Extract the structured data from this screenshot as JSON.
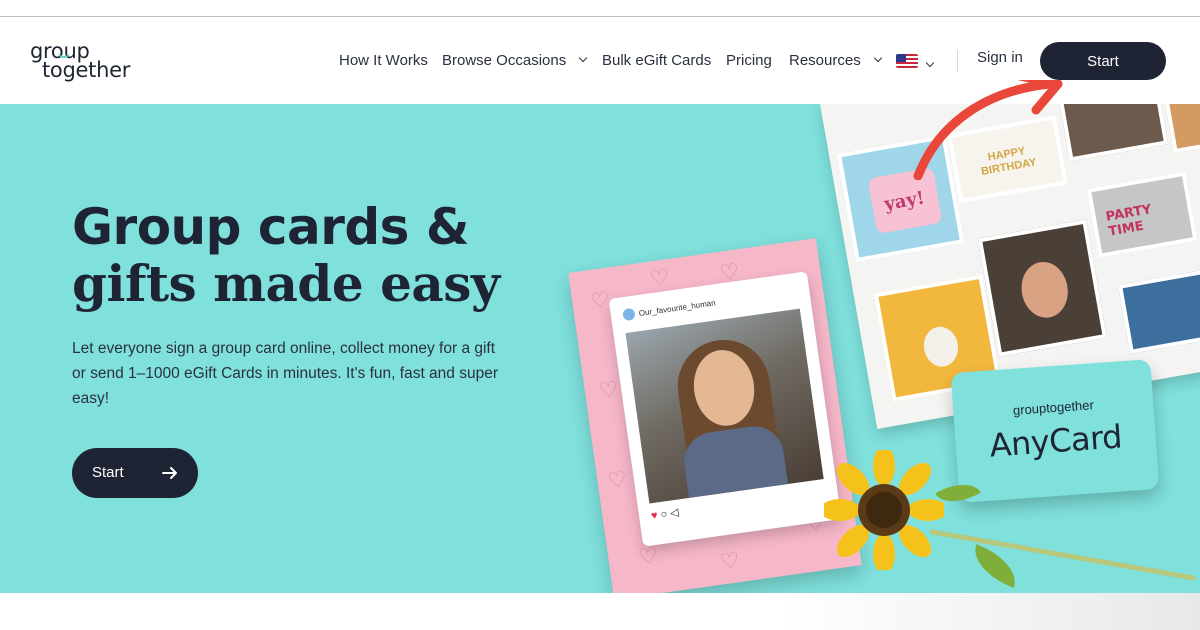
{
  "logo": {
    "line1": "group",
    "line2": "together"
  },
  "nav": {
    "items": [
      {
        "label": "How It Works",
        "dropdown": false
      },
      {
        "label": "Browse Occasions",
        "dropdown": true
      },
      {
        "label": "Bulk eGift Cards",
        "dropdown": false
      },
      {
        "label": "Pricing",
        "dropdown": false
      },
      {
        "label": "Resources",
        "dropdown": true
      }
    ],
    "locale_icon": "us-flag-icon",
    "sign_in": "Sign in",
    "start": "Start"
  },
  "hero": {
    "title_line1": "Group cards &",
    "title_line2": "gifts made easy",
    "subtitle": "Let everyone sign a group card online, collect money for a gift or send 1–1000 eGift Cards in minutes. It's fun, fast and super easy!",
    "cta_label": "Start",
    "cta_icon": "arrow-right-icon"
  },
  "collage": {
    "post_handle": "Our_favourite_human",
    "tiles_text": [
      "HAPPY BIRTHDAY",
      "yay!",
      "PARTY TIME"
    ],
    "anycard_brand": "grouptogether",
    "anycard_name": "AnyCard"
  },
  "colors": {
    "hero_bg": "#7fe0dc",
    "dark": "#1e2433",
    "pink_card": "#f6b7c9",
    "annotation_arrow": "#e8473a"
  }
}
